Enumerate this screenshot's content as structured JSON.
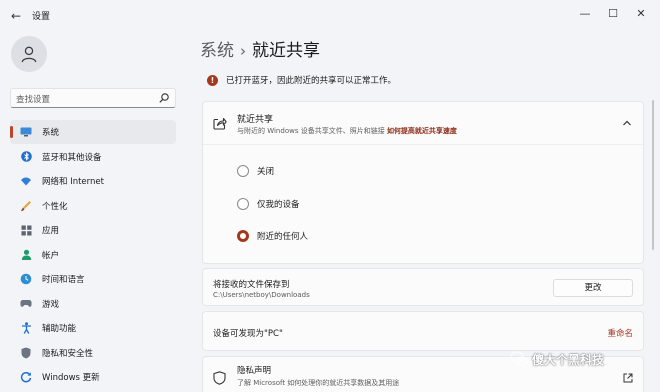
{
  "window": {
    "title": "设置",
    "back_glyph": "←",
    "minimize_glyph": "—",
    "maximize_glyph": "☐",
    "close_glyph": "✕"
  },
  "sidebar": {
    "search_placeholder": "查找设置",
    "items": [
      {
        "label": "系统",
        "icon": "monitor-icon",
        "active": true
      },
      {
        "label": "蓝牙和其他设备",
        "icon": "bluetooth-icon"
      },
      {
        "label": "网络和 Internet",
        "icon": "wifi-icon"
      },
      {
        "label": "个性化",
        "icon": "brush-icon"
      },
      {
        "label": "应用",
        "icon": "apps-icon"
      },
      {
        "label": "帐户",
        "icon": "account-icon"
      },
      {
        "label": "时间和语言",
        "icon": "globe-clock-icon"
      },
      {
        "label": "游戏",
        "icon": "gamepad-icon"
      },
      {
        "label": "辅助功能",
        "icon": "accessibility-icon"
      },
      {
        "label": "隐私和安全性",
        "icon": "shield-icon"
      },
      {
        "label": "Windows 更新",
        "icon": "update-icon"
      }
    ]
  },
  "main": {
    "breadcrumb_parent": "系统",
    "breadcrumb_sep": "›",
    "breadcrumb_current": "就近共享",
    "notice_icon": "!",
    "notice": "已打开蓝牙，因此附近的共享可以正常工作。",
    "nearby": {
      "title": "就近共享",
      "subtitle": "与附近的 Windows 设备共享文件、照片和链接",
      "link": "如何提高就近共享速度",
      "options": [
        {
          "label": "关闭",
          "checked": false
        },
        {
          "label": "仅我的设备",
          "checked": false
        },
        {
          "label": "附近的任何人",
          "checked": true
        }
      ]
    },
    "save": {
      "title": "将接收的文件保存到",
      "path": "C:\\Users\\netboy\\Downloads",
      "button": "更改"
    },
    "discover": {
      "label": "设备可发现为\"PC\"",
      "rename": "重命名"
    },
    "privacy": {
      "title": "隐私声明",
      "subtitle": "了解 Microsoft 如何处理你的就近共享数据及其用途"
    }
  },
  "watermark": {
    "text": "傻大个黑科技"
  },
  "colors": {
    "accent": "#a4381f",
    "background": "#f2f4f7",
    "card": "#fbfbfc"
  }
}
